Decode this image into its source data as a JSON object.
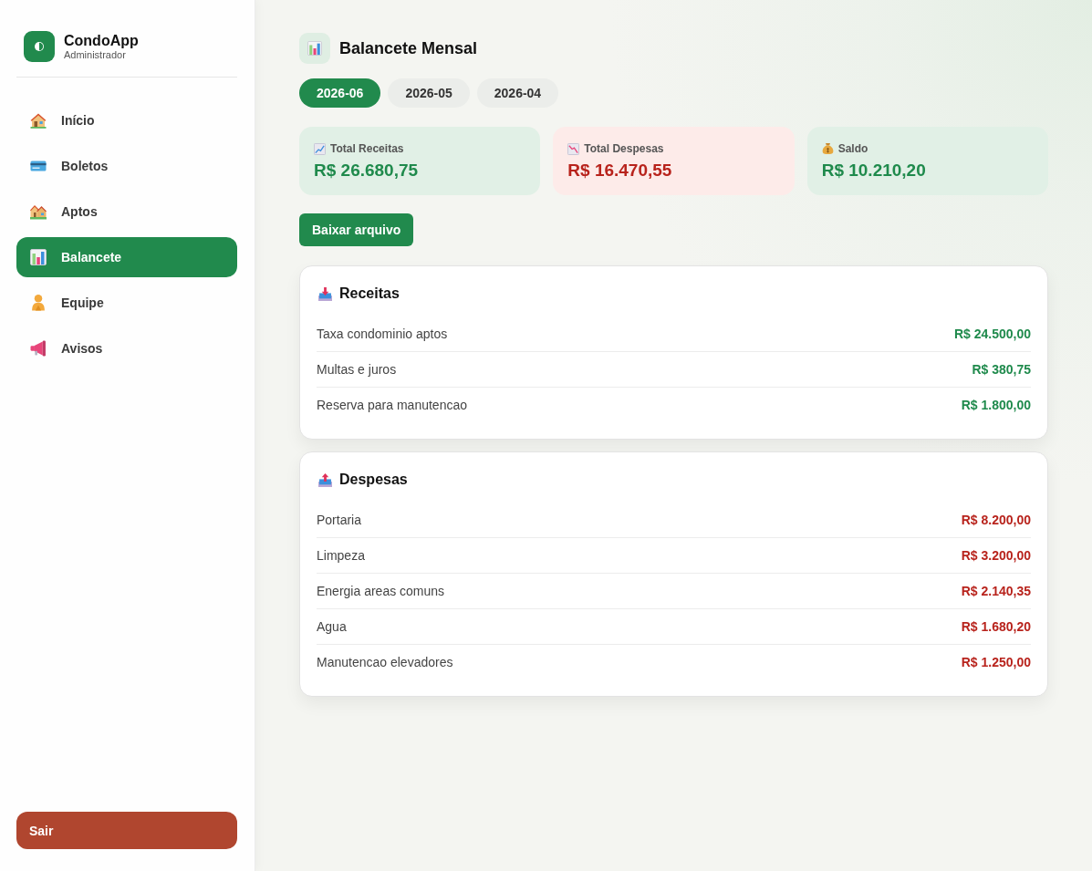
{
  "sidebar": {
    "brand": {
      "title": "CondoApp",
      "subtitle": "Administrador"
    },
    "items": [
      {
        "label": "Início",
        "selected": false
      },
      {
        "label": "Boletos",
        "selected": false
      },
      {
        "label": "Aptos",
        "selected": false
      },
      {
        "label": "Balancete",
        "selected": true
      },
      {
        "label": "Equipe",
        "selected": false
      },
      {
        "label": "Avisos",
        "selected": false
      }
    ],
    "logout": "Sair"
  },
  "header": {
    "title": "Balancete Mensal"
  },
  "tabs": [
    {
      "label": "2026-06",
      "selected": true
    },
    {
      "label": "2026-05",
      "selected": false
    },
    {
      "label": "2026-04",
      "selected": false
    }
  ],
  "summary": [
    {
      "label": "Total Receitas",
      "value": "R$ 26.680,75",
      "kind": "positive"
    },
    {
      "label": "Total Despesas",
      "value": "R$ 16.470,55",
      "kind": "negative"
    },
    {
      "label": "Saldo",
      "value": "R$ 10.210,20",
      "kind": "positive"
    }
  ],
  "download_button": "Baixar arquivo",
  "sections": [
    {
      "title": "Receitas",
      "kind": "positive",
      "rows": [
        {
          "label": "Taxa condominio aptos",
          "value": "R$ 24.500,00"
        },
        {
          "label": "Multas e juros",
          "value": "R$ 380,75"
        },
        {
          "label": "Reserva para manutencao",
          "value": "R$ 1.800,00"
        }
      ]
    },
    {
      "title": "Despesas",
      "kind": "negative",
      "rows": [
        {
          "label": "Portaria",
          "value": "R$ 8.200,00"
        },
        {
          "label": "Limpeza",
          "value": "R$ 3.200,00"
        },
        {
          "label": "Energia areas comuns",
          "value": "R$ 2.140,35"
        },
        {
          "label": "Agua",
          "value": "R$ 1.680,20"
        },
        {
          "label": "Manutencao elevadores",
          "value": "R$ 1.250,00"
        }
      ]
    }
  ]
}
